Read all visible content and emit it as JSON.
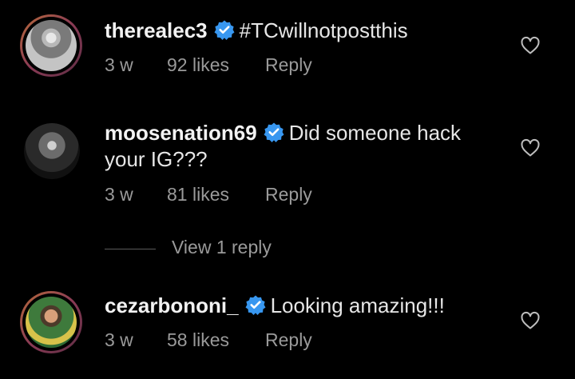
{
  "comments": [
    {
      "username": "therealec3",
      "verified": true,
      "text": "#TCwillnotpostthis",
      "time": "3 w",
      "likes": "92 likes",
      "reply_label": "Reply"
    },
    {
      "username": "moosenation69",
      "verified": true,
      "text": "Did someone hack",
      "text_line2": "your IG???",
      "time": "3 w",
      "likes": "81 likes",
      "reply_label": "Reply",
      "view_replies_label": "View 1 reply"
    },
    {
      "username": "cezarbononi_",
      "verified": true,
      "text": "Looking amazing!!!",
      "time": "3 w",
      "likes": "58 likes",
      "reply_label": "Reply"
    }
  ],
  "colors": {
    "background": "#000000",
    "verified_badge": "#3897f0",
    "secondary_text": "#9a9a9a",
    "primary_text": "#e6e6e6"
  },
  "icons": {
    "verified": "verified-badge-icon",
    "like": "heart-icon"
  }
}
